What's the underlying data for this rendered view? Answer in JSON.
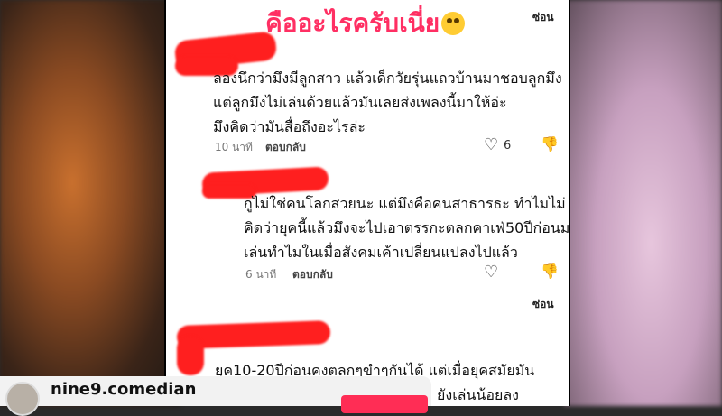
{
  "header": {
    "title": "คืออะไรครับเนี่ย",
    "emoji": "flushed-face",
    "hide_label": "ซ่อน"
  },
  "comments": [
    {
      "lines": [
        "ลองนึกว่ามึงมีลูกสาว แล้วเด็กวัยรุ่นแถวบ้านมาชอบลูกมึง",
        "แต่ลูกมึงไม่เล่นด้วยแล้วมันเลยส่งเพลงนี้มาให้อ่ะ",
        "มึงคิดว่ามันสื่อถึงอะไรล่ะ"
      ],
      "time": "10 นาที",
      "reply_label": "ตอบกลับ",
      "likes": "6"
    },
    {
      "lines": [
        "กูไม่ใช่คนโลกสวยนะ แต่มึงคือคนสาธารธะ ทำไมไม่",
        "คิดว่ายุคนี้แล้วมึงจะไปเอาตรรกะตลกคาเฟ่50ปีก่อนมา",
        "เล่นทำไมในเมื่อสังคมเค้าเปลี่ยนแปลงไปแล้ว"
      ],
      "time": "6 นาที",
      "reply_label": "ตอบกลับ",
      "hide_label": "ซ่อน"
    },
    {
      "lines": [
        "ยุค10-20ปีก่อนคงตลกๆขำๆกันได้ แต่เมื่อยุคสมัยมัน",
        "ยังเล่นน้อยลง"
      ]
    }
  ],
  "account": {
    "name": "nine9.comedian"
  },
  "colors": {
    "title": "#ff2f63",
    "scribble": "#ff1f1f",
    "follow": "#ff2d55"
  }
}
